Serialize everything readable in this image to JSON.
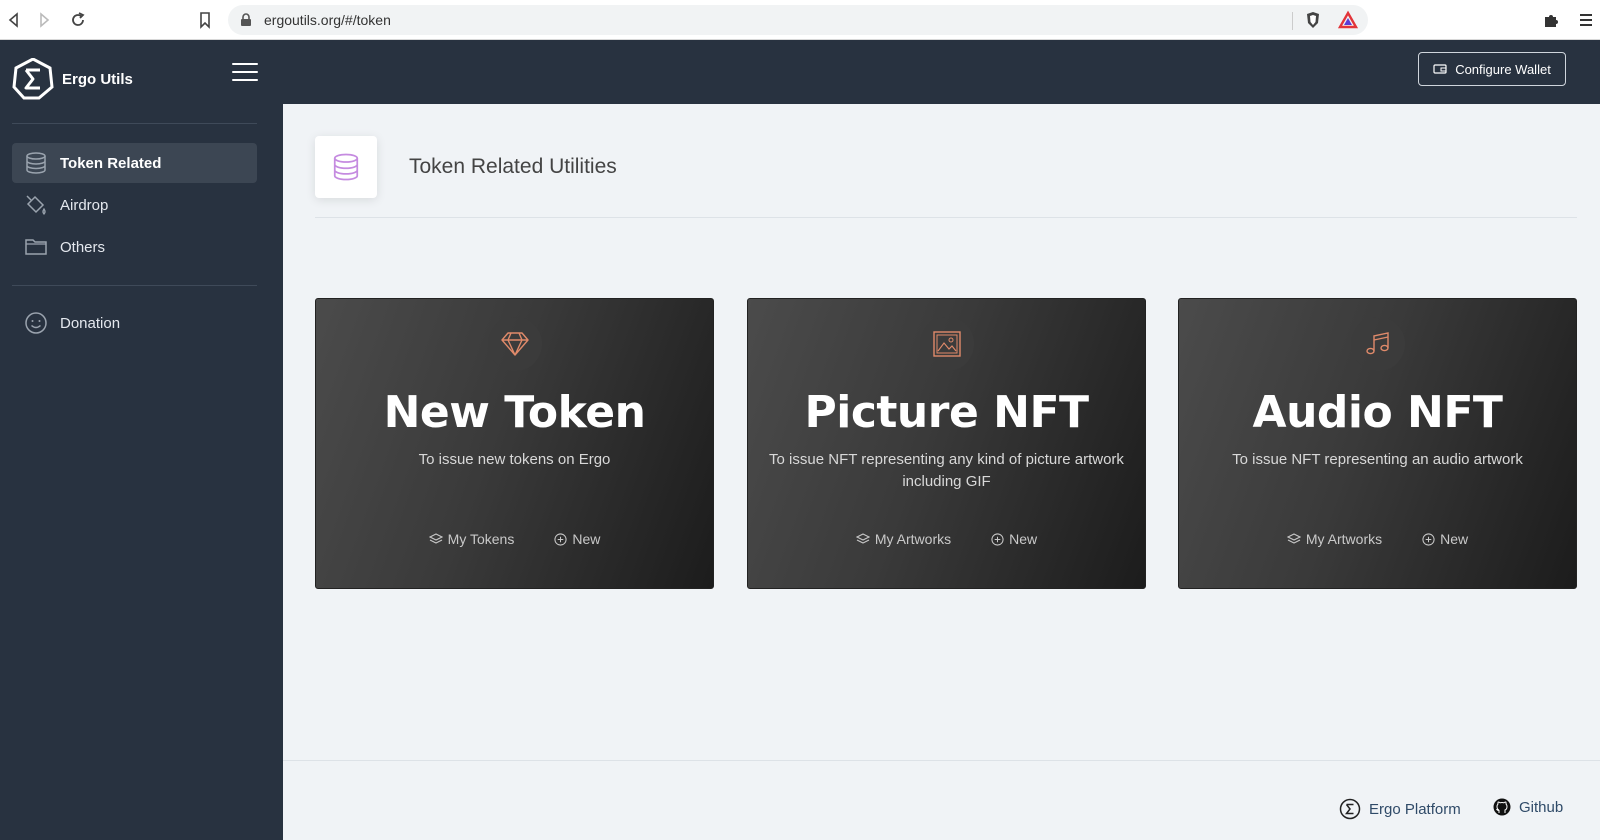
{
  "browser": {
    "url": "ergoutils.org/#/token"
  },
  "sidebar": {
    "brand": "Ergo Utils",
    "items": [
      {
        "label": "Token Related",
        "icon": "database-icon",
        "active": true
      },
      {
        "label": "Airdrop",
        "icon": "paint-bucket-icon",
        "active": false
      },
      {
        "label": "Others",
        "icon": "folder-icon",
        "active": false
      },
      {
        "label": "Donation",
        "icon": "smile-icon",
        "active": false
      }
    ]
  },
  "header": {
    "wallet_button": "Configure Wallet"
  },
  "page": {
    "title": "Token Related Utilities",
    "icon": "database-icon"
  },
  "cards": [
    {
      "title": "New Token",
      "desc": "To issue new tokens on Ergo",
      "icon": "diamond-icon",
      "link1": "My Tokens",
      "link2": "New"
    },
    {
      "title": "Picture NFT",
      "desc": "To issue NFT representing any kind of picture artwork including GIF",
      "icon": "image-icon",
      "link1": "My Artworks",
      "link2": "New"
    },
    {
      "title": "Audio NFT",
      "desc": "To issue NFT representing an audio artwork",
      "icon": "music-icon",
      "link1": "My Artworks",
      "link2": "New"
    }
  ],
  "footer": {
    "platform": "Ergo Platform",
    "github": "Github"
  },
  "colors": {
    "sidebar": "#283240",
    "accent_icon": "#e08a6a",
    "footer_link": "#2f4a68"
  }
}
